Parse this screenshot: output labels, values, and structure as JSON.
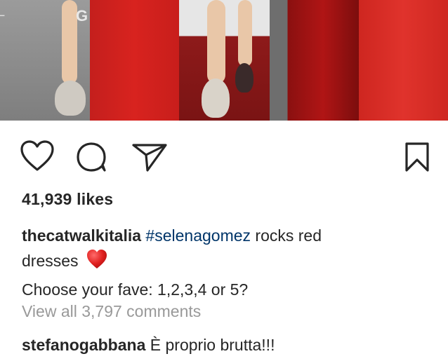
{
  "post": {
    "likes_text": "41,939 likes",
    "caption": {
      "username": "thecatwalkitalia",
      "hashtag": "#selenagomez",
      "text_line1": " rocks red",
      "text_line2": "dresses",
      "emoji": "red-heart",
      "text_line3": "Choose your fave: 1,2,3,4 or 5?"
    },
    "view_all_comments": "View all 3,797 comments",
    "comments": [
      {
        "username": "stefanogabbana",
        "text": " È proprio brutta!!!"
      }
    ]
  },
  "actions": {
    "icons": [
      "heart-icon",
      "comment-icon",
      "share-icon",
      "bookmark-icon"
    ]
  }
}
